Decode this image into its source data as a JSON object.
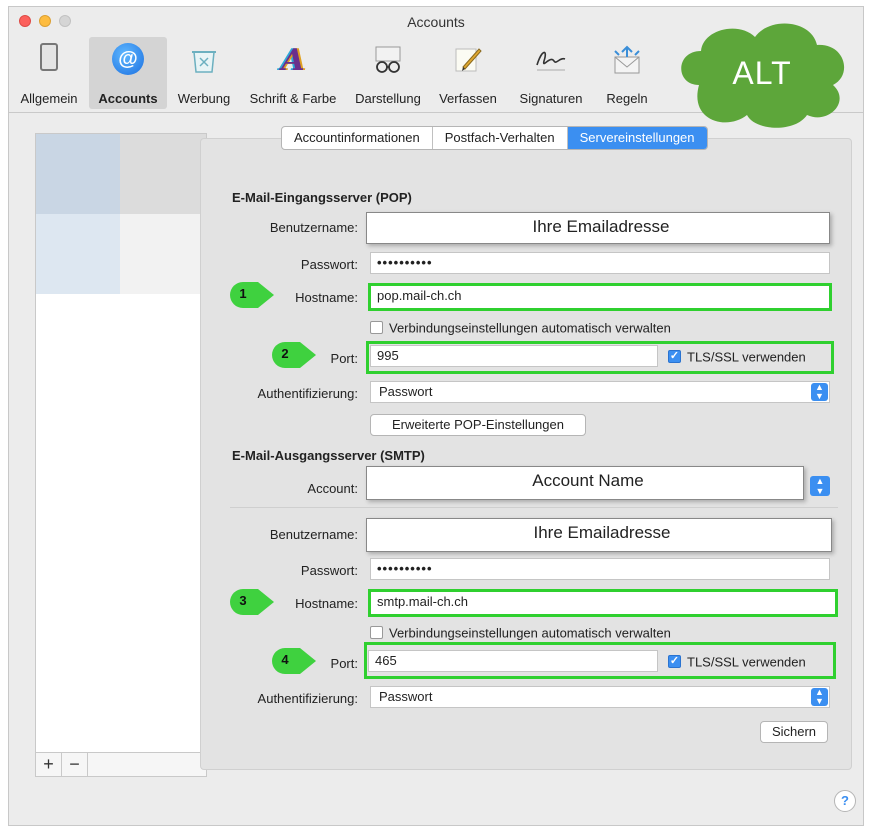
{
  "window": {
    "title": "Accounts"
  },
  "toolbar": {
    "items": [
      {
        "label": "Allgemein",
        "icon": "general-icon"
      },
      {
        "label": "Accounts",
        "icon": "at-sign-icon",
        "active": true
      },
      {
        "label": "Werbung",
        "icon": "junk-trash-icon"
      },
      {
        "label": "Schrift & Farbe",
        "icon": "fonts-colors-icon"
      },
      {
        "label": "Darstellung",
        "icon": "glasses-icon"
      },
      {
        "label": "Verfassen",
        "icon": "pencil-icon"
      },
      {
        "label": "Signaturen",
        "icon": "signature-icon"
      },
      {
        "label": "Regeln",
        "icon": "rules-envelope-icon"
      }
    ]
  },
  "overlay": {
    "cloud_text": "ALT",
    "cloud_color": "#5da63a"
  },
  "tabs": [
    {
      "label": "Accountinformationen"
    },
    {
      "label": "Postfach-Verhalten"
    },
    {
      "label": "Servereinstellungen",
      "selected": true
    }
  ],
  "incoming": {
    "heading": "E-Mail-Eingangsserver (POP)",
    "username_label": "Benutzername:",
    "username_value": "Ihre Emailadresse",
    "password_label": "Passwort:",
    "password_value": "••••••••••",
    "hostname_label": "Hostname:",
    "hostname_value": "pop.mail-ch.ch",
    "auto_manage_label": "Verbindungseinstellungen automatisch verwalten",
    "auto_manage_checked": false,
    "port_label": "Port:",
    "port_value": "995",
    "tls_label": "TLS/SSL verwenden",
    "tls_checked": true,
    "auth_label": "Authentifizierung:",
    "auth_value": "Passwort",
    "advanced_button": "Erweiterte POP-Einstellungen"
  },
  "outgoing": {
    "heading": "E-Mail-Ausgangsserver (SMTP)",
    "account_label": "Account:",
    "account_value": "Account Name",
    "username_label": "Benutzername:",
    "username_value": "Ihre Emailadresse",
    "password_label": "Passwort:",
    "password_value": "••••••••••",
    "hostname_label": "Hostname:",
    "hostname_value": "smtp.mail-ch.ch",
    "auto_manage_label": "Verbindungseinstellungen automatisch verwalten",
    "auto_manage_checked": false,
    "port_label": "Port:",
    "port_value": "465",
    "tls_label": "TLS/SSL verwenden",
    "tls_checked": true,
    "auth_label": "Authentifizierung:",
    "auth_value": "Passwort"
  },
  "markers": [
    "1",
    "2",
    "3",
    "4"
  ],
  "list_footer": {
    "add": "+",
    "remove": "−"
  },
  "buttons": {
    "save": "Sichern",
    "help": "?"
  },
  "colors": {
    "accent": "#3b8ff1",
    "highlight": "#2fd02f",
    "marker": "#3fd13f"
  }
}
